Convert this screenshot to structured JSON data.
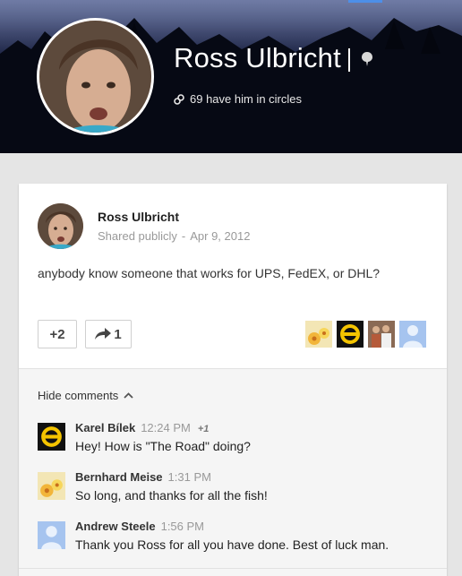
{
  "profile": {
    "name": "Ross Ulbricht",
    "circles_text": "69 have him in circles"
  },
  "post": {
    "author": "Ross Ulbricht",
    "visibility": "Shared publicly",
    "separator": "-",
    "date": "Apr 9, 2012",
    "text": "anybody know someone that works for UPS, FedEX, or DHL?",
    "plus_label": "+2",
    "share_count": "1"
  },
  "comments_section": {
    "toggle_label": "Hide comments",
    "items": [
      {
        "author": "Karel Bílek",
        "time": "12:24 PM",
        "plus": "+1",
        "text": "Hey! How is \"The Road\" doing?"
      },
      {
        "author": "Bernhard Meise",
        "time": "1:31 PM",
        "plus": "",
        "text": "So long, and thanks for all the fish!"
      },
      {
        "author": "Andrew Steele",
        "time": "1:56 PM",
        "plus": "",
        "text": "Thank you Ross for all you have done. Best of luck man."
      }
    ]
  },
  "icons": {
    "pin": "pin-icon",
    "circles": "circles-icon",
    "share": "share-arrow-icon",
    "chevron": "chevron-up-icon"
  },
  "colors": {
    "accent_tab": "#4d8fe8",
    "card_bg": "#ffffff",
    "page_bg": "#e5e5e5",
    "lantern_yellow": "#f4c400"
  }
}
